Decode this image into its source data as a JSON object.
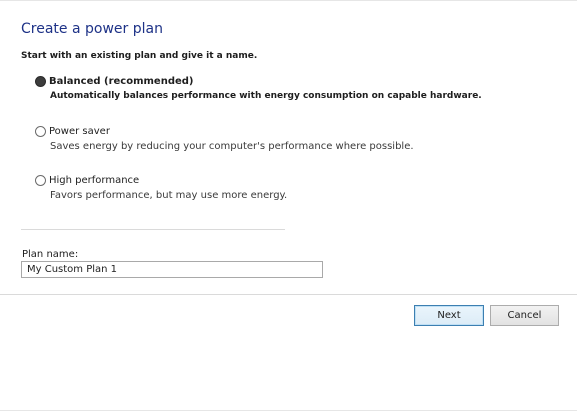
{
  "page": {
    "title": "Create a power plan",
    "subtitle": "Start with an existing plan and give it a name."
  },
  "plans": [
    {
      "label": "Balanced (recommended)",
      "description": "Automatically balances performance with energy consumption on capable hardware.",
      "selected": true
    },
    {
      "label": "Power saver",
      "description": "Saves energy by reducing your computer's performance where possible.",
      "selected": false
    },
    {
      "label": "High performance",
      "description": "Favors performance, but may use more energy.",
      "selected": false
    }
  ],
  "plan_name": {
    "label": "Plan name:",
    "value": "My Custom Plan 1"
  },
  "buttons": {
    "next": "Next",
    "cancel": "Cancel"
  },
  "colors": {
    "title": "#1e3287",
    "default_button_border": "#3c7fb1"
  }
}
